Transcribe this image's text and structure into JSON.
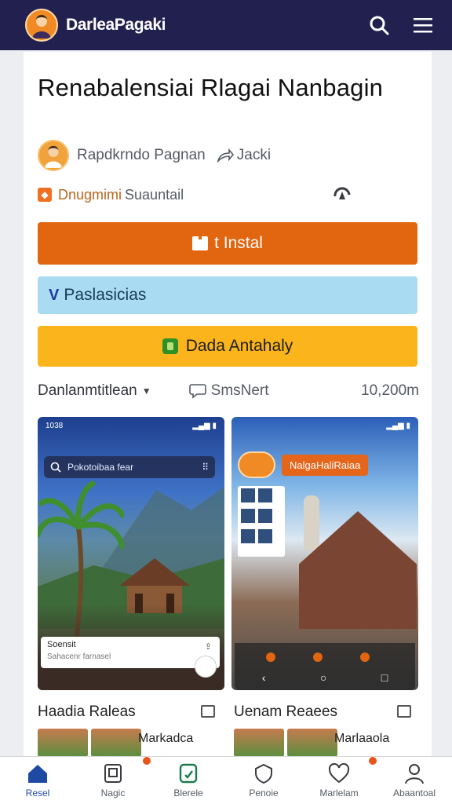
{
  "topbar": {
    "title": "DarleaPagaki",
    "icons": [
      "avatar",
      "search-icon",
      "menu-icon"
    ]
  },
  "app": {
    "name": "Renabalensiai Rlagai Nanbagin",
    "developer": "Rapdkrndo Pagnan",
    "share_label": "Jacki",
    "category": "Dnugmimi",
    "category_sub": "Suauntail"
  },
  "buttons": {
    "install": "t Instal",
    "preview": "Paslasicias",
    "data": "Dada Antahaly"
  },
  "meta": {
    "sort": "Danlanmtitlean",
    "reviews": "SmsNert",
    "downloads": "10,200m"
  },
  "screenshot1": {
    "status_time": "1038",
    "search_text": "Pokotoibaa fear",
    "card_title": "Soensit",
    "card_sub": "Sahacenr farnasel"
  },
  "screenshot2": {
    "title": "NalgaHaliRaiaa"
  },
  "related": [
    {
      "section": "Haadia Raleas",
      "name": "Markadca"
    },
    {
      "section": "Uenam Reaees",
      "name": "Marlaaola"
    }
  ],
  "bottomnav": [
    {
      "label": "Resel",
      "icon": "home-icon"
    },
    {
      "label": "Nagic",
      "icon": "tablet-icon"
    },
    {
      "label": "Blerele",
      "icon": "document-icon"
    },
    {
      "label": "Penoie",
      "icon": "shield-icon"
    },
    {
      "label": "Marlelam",
      "icon": "heart-icon"
    },
    {
      "label": "Abaantoal",
      "icon": "person-icon"
    }
  ],
  "colors": {
    "brand": "#22204f",
    "install": "#e2650f",
    "preview": "#a9dcf3",
    "data": "#fbb41c"
  }
}
